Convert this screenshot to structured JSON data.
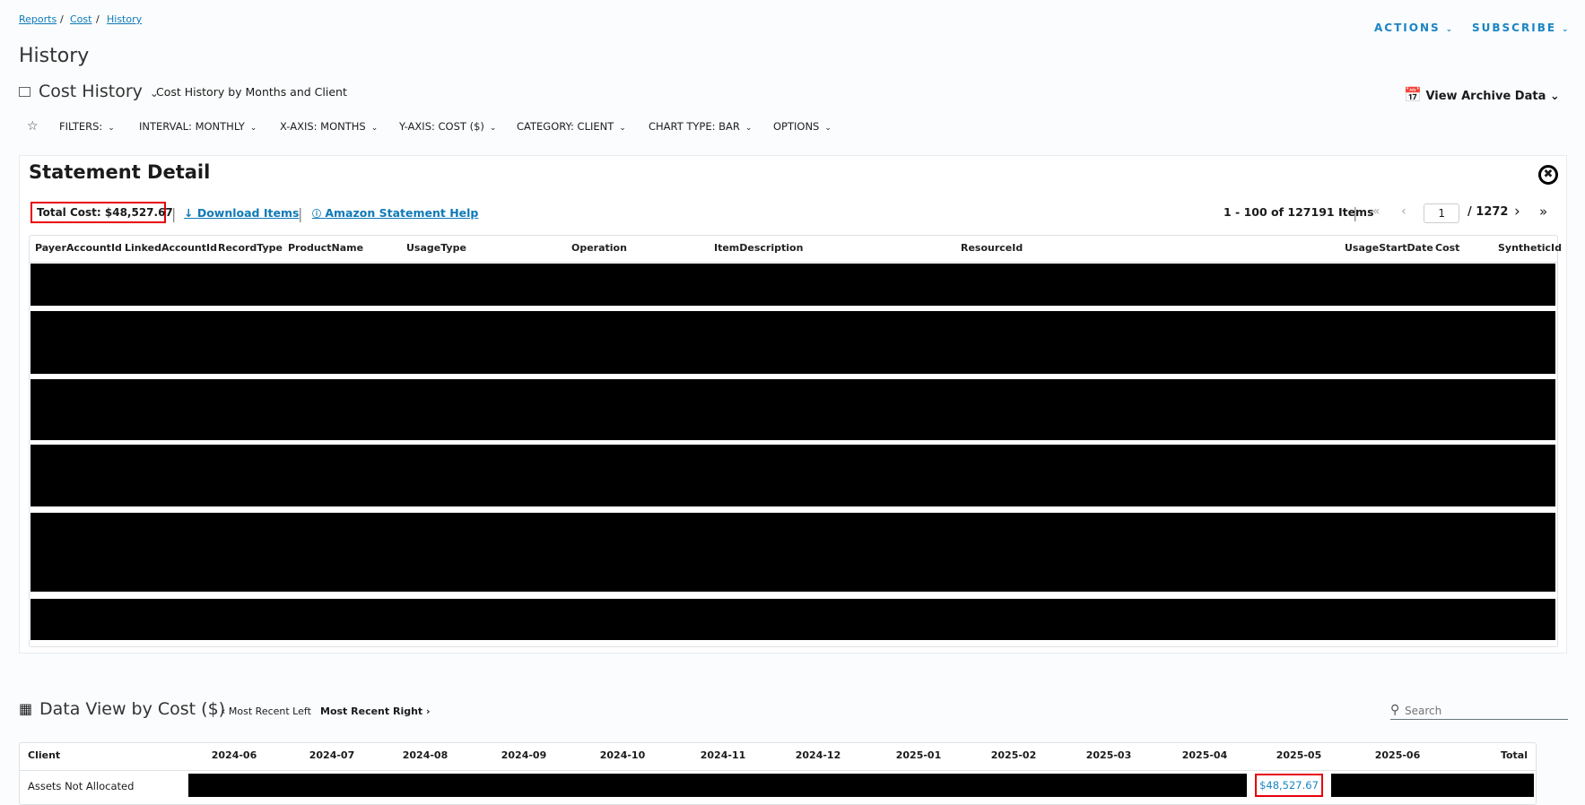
{
  "breadcrumb": [
    "Reports",
    "Cost",
    "History"
  ],
  "header": {
    "actions": "ACTIONS",
    "subscribe": "SUBSCRIBE",
    "title": "History",
    "report": "Cost History",
    "subtitle": "Cost History by Months and Client",
    "archive": "View Archive Data"
  },
  "toolbar": [
    "FILTERS:",
    "INTERVAL:  MONTHLY",
    "X-AXIS:  MONTHS",
    "Y-AXIS:  COST ($)",
    "CATEGORY:  CLIENT",
    "CHART TYPE:  BAR",
    "OPTIONS"
  ],
  "statement": {
    "title": "Statement Detail",
    "total": "Total Cost: $48,527.67",
    "download": "Download Items",
    "help": "Amazon Statement Help",
    "range": "1 - 100 of 127191 Items",
    "page": "1",
    "pages": "/  1272",
    "columns": [
      "PayerAccountId",
      "LinkedAccountId",
      "RecordType",
      "ProductName",
      "UsageType",
      "Operation",
      "ItemDescription",
      "ResourceId",
      "UsageStartDate",
      "Cost",
      "SyntheticId"
    ]
  },
  "dataview": {
    "title": "Data View by Cost ($)",
    "left": "Most Recent Left",
    "right": "Most Recent Right",
    "search_placeholder": "Search",
    "columns": [
      "Client",
      "2024-06",
      "2024-07",
      "2024-08",
      "2024-09",
      "2024-10",
      "2024-11",
      "2024-12",
      "2025-01",
      "2025-02",
      "2025-03",
      "2025-04",
      "2025-05",
      "2025-06",
      "Total"
    ],
    "row": {
      "client": "Assets Not Allocated",
      "may": "$48,527.67"
    }
  },
  "colors": {
    "link": "#0f7ab8",
    "highlight": "#e8000b"
  }
}
